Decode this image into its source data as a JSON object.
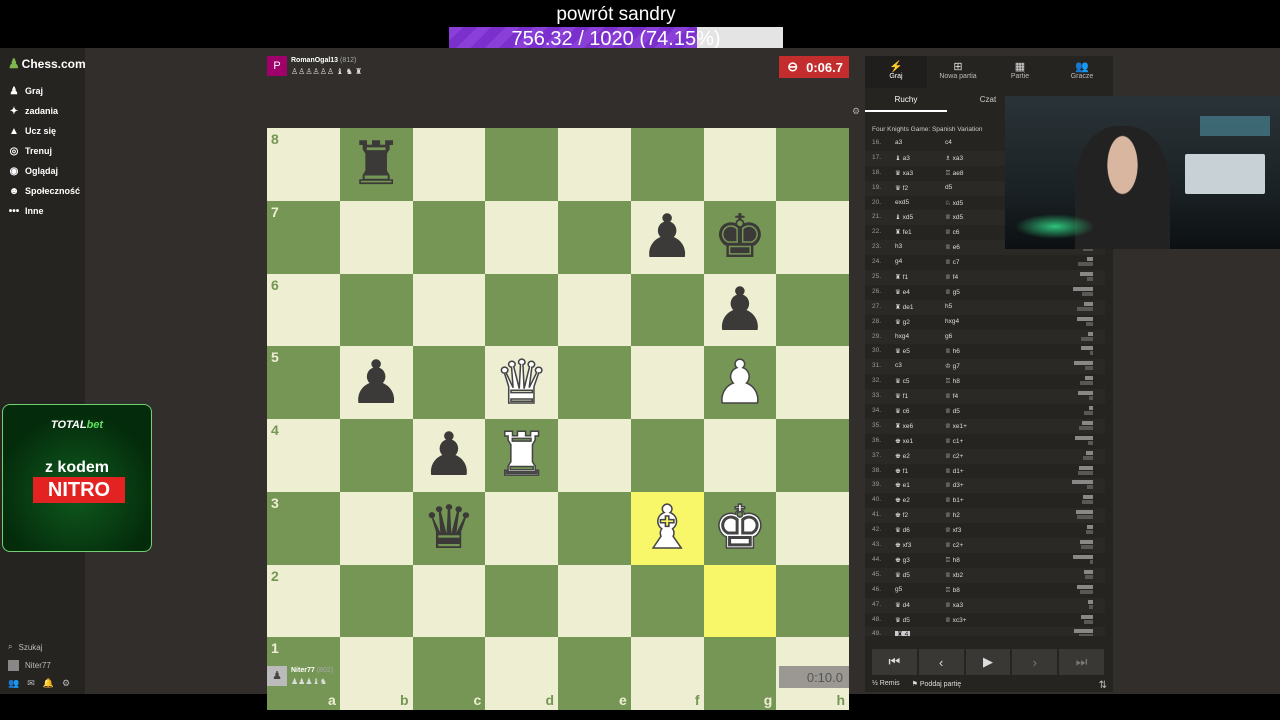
{
  "overlay": {
    "title": "powrót sandry",
    "progress_text": "756.32 / 1020 (74.15%)",
    "progress_fraction": 0.7415
  },
  "colors": {
    "board_light": "#eeeed2",
    "board_dark": "#769656",
    "highlight": "#f7f769",
    "clock_active": "#c42d2d",
    "progress_purple": "#8a3fd9"
  },
  "sidebar": {
    "logo": "Chess.com",
    "items": [
      {
        "label": "Graj",
        "icon": "pawn-icon"
      },
      {
        "label": "zadania",
        "icon": "puzzle-icon"
      },
      {
        "label": "Ucz się",
        "icon": "graduation-icon"
      },
      {
        "label": "Trenuj",
        "icon": "target-icon"
      },
      {
        "label": "Oglądaj",
        "icon": "binoculars-icon"
      },
      {
        "label": "Społeczność",
        "icon": "people-icon"
      },
      {
        "label": "Inne",
        "icon": "more-icon"
      }
    ],
    "search_label": "Szukaj",
    "username": "Niter77"
  },
  "promo": {
    "brand_a": "TOTAL",
    "brand_b": "bet",
    "line1": "z kodem",
    "code": "NITRO"
  },
  "top_player": {
    "initial": "P",
    "name": "RomanOgal13",
    "rating": "(812)",
    "captured": "♙♙♙♙♙♙ ♝ ♞ ♜",
    "clock": "0:06.7"
  },
  "bottom_player": {
    "name": "Niter77",
    "rating": "(802)",
    "captured": "♟♟♟♝♞",
    "clock": "0:10.0"
  },
  "board": {
    "ranks": [
      "8",
      "7",
      "6",
      "5",
      "4",
      "3",
      "2",
      "1"
    ],
    "files": [
      "a",
      "b",
      "c",
      "d",
      "e",
      "f",
      "g",
      "h"
    ],
    "pieces": [
      {
        "square": "b8",
        "color": "black",
        "glyph": "♜"
      },
      {
        "square": "f7",
        "color": "black",
        "glyph": "♟"
      },
      {
        "square": "g7",
        "color": "black",
        "glyph": "♚"
      },
      {
        "square": "g6",
        "color": "black",
        "glyph": "♟"
      },
      {
        "square": "b5",
        "color": "black",
        "glyph": "♟"
      },
      {
        "square": "d5",
        "color": "white",
        "glyph": "♛"
      },
      {
        "square": "g5",
        "color": "white",
        "glyph": "♟"
      },
      {
        "square": "c4",
        "color": "black",
        "glyph": "♟"
      },
      {
        "square": "d4",
        "color": "white",
        "glyph": "♜"
      },
      {
        "square": "c3",
        "color": "black",
        "glyph": "♛"
      },
      {
        "square": "f3",
        "color": "white",
        "glyph": "♝"
      },
      {
        "square": "g3",
        "color": "white",
        "glyph": "♚"
      }
    ],
    "highlighted": [
      "f3",
      "g2"
    ]
  },
  "panel": {
    "tabs": [
      {
        "label": "Graj",
        "icon": "bolt-icon"
      },
      {
        "label": "Nowa partia",
        "icon": "plus-icon"
      },
      {
        "label": "Partie",
        "icon": "grid-icon"
      },
      {
        "label": "Gracze",
        "icon": "users-icon"
      }
    ],
    "subtabs": [
      "Ruchy",
      "Czat"
    ],
    "opening": "Four Knights Game: Spanish Variation",
    "moves": [
      {
        "n": "16.",
        "w": "a3",
        "b": "c4"
      },
      {
        "n": "17.",
        "w": "♝ a3",
        "b": "♗ xa3"
      },
      {
        "n": "18.",
        "w": "♛ xa3",
        "b": "♖ ae8"
      },
      {
        "n": "19.",
        "w": "♛ f2",
        "b": "d5"
      },
      {
        "n": "20.",
        "w": "exd5",
        "b": "♘ xd5"
      },
      {
        "n": "21.",
        "w": "♝ xd5",
        "b": "♕ xd5"
      },
      {
        "n": "22.",
        "w": "♜ fe1",
        "b": "♕ c6"
      },
      {
        "n": "23.",
        "w": "h3",
        "b": "♕ e6"
      },
      {
        "n": "24.",
        "w": "g4",
        "b": "♕ c7"
      },
      {
        "n": "25.",
        "w": "♜ f1",
        "b": "♕ f4"
      },
      {
        "n": "26.",
        "w": "♛ e4",
        "b": "♕ g5"
      },
      {
        "n": "27.",
        "w": "♜ de1",
        "b": "h5"
      },
      {
        "n": "28.",
        "w": "♛ g2",
        "b": "hxg4"
      },
      {
        "n": "29.",
        "w": "hxg4",
        "b": "g6"
      },
      {
        "n": "30.",
        "w": "♛ e5",
        "b": "♕ h6"
      },
      {
        "n": "31.",
        "w": "c3",
        "b": "♔ g7"
      },
      {
        "n": "32.",
        "w": "♛ c5",
        "b": "♖ h8"
      },
      {
        "n": "33.",
        "w": "♛ f1",
        "b": "♕ f4"
      },
      {
        "n": "34.",
        "w": "♛ c6",
        "b": "♕ d5"
      },
      {
        "n": "35.",
        "w": "♜ xe6",
        "b": "♕ xe1+"
      },
      {
        "n": "36.",
        "w": "♚ xe1",
        "b": "♕ c1+"
      },
      {
        "n": "37.",
        "w": "♚ e2",
        "b": "♕ c2+"
      },
      {
        "n": "38.",
        "w": "♚ f1",
        "b": "♕ d1+"
      },
      {
        "n": "39.",
        "w": "♚ e1",
        "b": "♕ d3+"
      },
      {
        "n": "40.",
        "w": "♚ e2",
        "b": "♕ b1+"
      },
      {
        "n": "41.",
        "w": "♚ f2",
        "b": "♕ h2"
      },
      {
        "n": "42.",
        "w": "♛ d6",
        "b": "♕ xf3"
      },
      {
        "n": "43.",
        "w": "♚ xf3",
        "b": "♕ c2+"
      },
      {
        "n": "44.",
        "w": "♚ g3",
        "b": "♖ h8"
      },
      {
        "n": "45.",
        "w": "♛ d5",
        "b": "♕ xb2"
      },
      {
        "n": "46.",
        "w": "g5",
        "b": "♖ b8"
      },
      {
        "n": "47.",
        "w": "♛ d4",
        "b": "♕ xa3"
      },
      {
        "n": "48.",
        "w": "♛ d5",
        "b": "♕ xc3+"
      },
      {
        "n": "49.",
        "w": "♜ 4",
        "b": ""
      }
    ],
    "remis_label": "Remis",
    "resign_label": "Poddaj partię"
  }
}
